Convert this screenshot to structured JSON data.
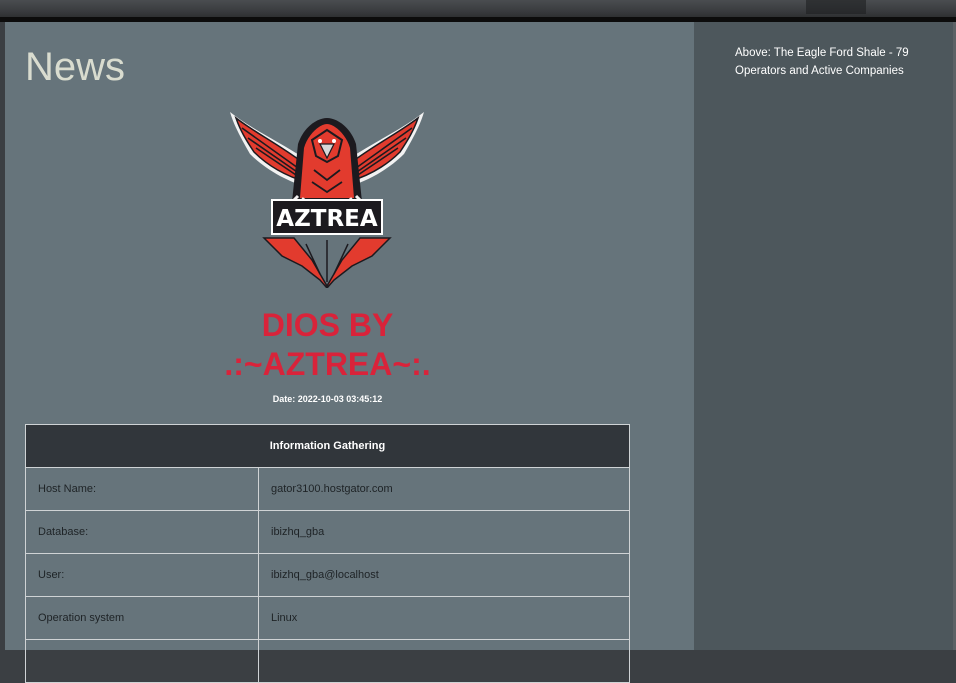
{
  "page": {
    "title": "News"
  },
  "logo": {
    "text": "AZTREA",
    "colors": {
      "red": "#e23b2e",
      "dark": "#1c1a1f",
      "white": "#ffffff"
    }
  },
  "dios": {
    "line1": "DIOS BY",
    "line2": ".:~AZTREA~:.",
    "date": "Date: 2022-10-03 03:45:12",
    "color": "#d9233a"
  },
  "table": {
    "header": "Information Gathering",
    "rows": [
      {
        "label": "Host Name:",
        "value": "gator3100.hostgator.com"
      },
      {
        "label": "Database:",
        "value": "ibizhq_gba"
      },
      {
        "label": "User:",
        "value": "ibizhq_gba@localhost"
      },
      {
        "label": "Operation system",
        "value": "Linux"
      },
      {
        "label": "",
        "value": ""
      }
    ]
  },
  "sidebar": {
    "caption": "Above: The Eagle Ford Shale - 79 Operators and Active Companies"
  }
}
